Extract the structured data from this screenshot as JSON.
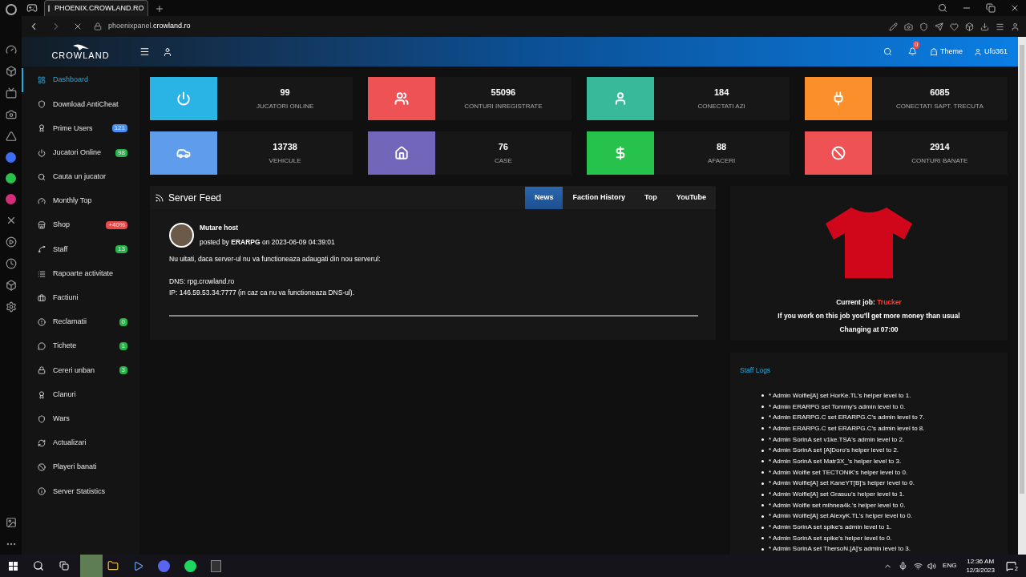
{
  "browser": {
    "tab_title": "PHOENIX.CROWLAND.RO",
    "url_prefix": "phoenixpanel.",
    "url_domain": "crowland.ro"
  },
  "header": {
    "brand": "CROWLAND",
    "notification_count": "0",
    "theme": "Theme",
    "user": "Ufo361"
  },
  "sidebar": {
    "items": [
      {
        "label": "Dashboard",
        "kind": "dashboard",
        "selected": true
      },
      {
        "label": "Download AntiCheat",
        "kind": "shield",
        "selected": false
      },
      {
        "label": "Prime Users",
        "kind": "award",
        "badge": "121",
        "color": "#4a8ff0",
        "selected": false
      },
      {
        "label": "Jucatori Online",
        "kind": "power",
        "badge": "98",
        "color": "#28b44a",
        "selected": false
      },
      {
        "label": "Cauta un jucator",
        "kind": "search",
        "selected": false
      },
      {
        "label": "Monthly Top",
        "kind": "gauge",
        "selected": false
      },
      {
        "label": "Shop",
        "kind": "shop",
        "badge": "+40%",
        "color": "#e84a4a",
        "selected": false
      },
      {
        "label": "Staff",
        "kind": "staff",
        "badge": "13",
        "color": "#28b44a",
        "selected": false
      },
      {
        "label": "Rapoarte activitate",
        "kind": "list",
        "selected": false
      },
      {
        "label": "Factiuni",
        "kind": "briefcase",
        "selected": false
      },
      {
        "label": "Reclamatii",
        "kind": "alert",
        "badge": "0",
        "color": "#28b44a",
        "selected": false
      },
      {
        "label": "Tichete",
        "kind": "chat",
        "badge": "1",
        "color": "#28b44a",
        "selected": false
      },
      {
        "label": "Cereri unban",
        "kind": "lock",
        "badge": "3",
        "color": "#28b44a",
        "selected": false
      },
      {
        "label": "Clanuri",
        "kind": "award",
        "selected": false
      },
      {
        "label": "Wars",
        "kind": "shield",
        "selected": false
      },
      {
        "label": "Actualizari",
        "kind": "refresh",
        "selected": false
      },
      {
        "label": "Playeri banati",
        "kind": "ban",
        "selected": false
      },
      {
        "label": "Server Statistics",
        "kind": "info",
        "selected": false
      }
    ]
  },
  "stats": [
    {
      "value": "99",
      "label": "JUCATORI ONLINE",
      "kind": "power",
      "color": "#2ab4e6"
    },
    {
      "value": "55096",
      "label": "CONTURI INREGISTRATE",
      "kind": "users",
      "color": "#ee5255"
    },
    {
      "value": "184",
      "label": "CONECTATI AZI",
      "kind": "user",
      "color": "#38b99a"
    },
    {
      "value": "6085",
      "label": "CONECTATI SAPT. TRECUTA",
      "kind": "plug",
      "color": "#fb8f2c"
    },
    {
      "value": "13738",
      "label": "VEHICULE",
      "kind": "car",
      "color": "#5f9cec"
    },
    {
      "value": "76",
      "label": "CASE",
      "kind": "home",
      "color": "#7266ba"
    },
    {
      "value": "88",
      "label": "AFACERI",
      "kind": "dollar",
      "color": "#27c24c"
    },
    {
      "value": "2914",
      "label": "CONTURI BANATE",
      "kind": "ban",
      "color": "#ee5255"
    }
  ],
  "feed": {
    "title": "Server Feed",
    "tabs": [
      {
        "label": "News",
        "selected": true
      },
      {
        "label": "Faction History",
        "selected": false
      },
      {
        "label": "Top",
        "selected": false
      },
      {
        "label": "YouTube",
        "selected": false
      }
    ],
    "post": {
      "title": "Mutare host",
      "byline": "posted by **ERARPG** on 2023-06-09 04:39:01",
      "paragraphs": [
        [
          "Nu uitati, daca server-ul nu va functioneaza adaugati din nou serverul:"
        ],
        [
          "DNS: rpg.crowland.ro",
          "IP: 146.59.53.34:7777 (in caz ca nu va functioneaza DNS-ul)."
        ]
      ]
    }
  },
  "job": {
    "label": "Current job:",
    "job": "Trucker",
    "note": "If you work on this job you'll get more money than usual",
    "changing": "Changing at 07:00"
  },
  "staff_logs": {
    "title": "Staff Logs",
    "entries": [
      "* Admin Wolfie[A] set HorKe.TL's helper level to 1.",
      "* Admin ERARPG set Tommy's admin level to 0.",
      "* Admin ERARPG.C set ERARPG.C's admin level to 7.",
      "* Admin ERARPG.C set ERARPG.C's admin level to 8.",
      "* Admin SorinA set v1ke.TSA's admin level to 2.",
      "* Admin SorinA set [A]Doro's helper level to 2.",
      "* Admin SorinA set Matr3X_'s helper level to 3.",
      "* Admin Wolfie set TECTONiK's helper level to 0.",
      "* Admin Wolfie[A] set KaneYT[B]'s helper level to 0.",
      "* Admin Wolfie[A] set Grasuu's helper level to 1.",
      "* Admin Wolfie set mihnea4k.'s helper level to 0.",
      "* Admin Wolfie[A] set AlexyK.TL's helper level to 0.",
      "* Admin SorinA set spike's admin level to 1.",
      "* Admin SorinA set spike's helper level to 0.",
      "* Admin SorinA set ThersoN.[A]'s admin level to 3."
    ]
  },
  "taskbar": {
    "language": "ENG",
    "time": "12:36 AM",
    "date": "12/3/2023",
    "notifications": "2"
  }
}
